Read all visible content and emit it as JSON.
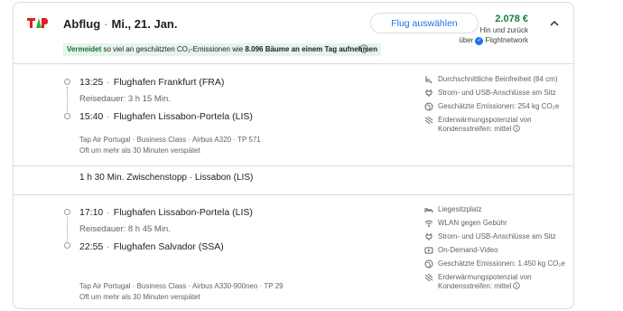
{
  "header": {
    "airline_logo": "TAP",
    "departure_label": "Abflug",
    "date": "Mi., 21. Jan.",
    "select_button": "Flug auswählen",
    "price": "2.078 €",
    "price_type": "Hin und zurück",
    "booking_via_prefix": "über",
    "booking_via": "Flightnetwork",
    "collapse_icon": "chevron-up-icon"
  },
  "emissions_banner": {
    "highlight": "Vermeidet",
    "text_middle": "so viel an geschätzten CO₂-Emissionen wie",
    "trees": "8.096 Bäume an einem Tag aufnehmen",
    "colors": {
      "highlight": "#137333",
      "background": "#e6f4ea"
    }
  },
  "segments": [
    {
      "dep_time": "13:25",
      "dep_airport": "Flughafen Frankfurt (FRA)",
      "duration": "Reisedauer: 3 h 15 Min.",
      "arr_time": "15:40",
      "arr_airport": "Flughafen Lissabon-Portela (LIS)",
      "airline": "Tap Air Portugal",
      "cabin": "Business Class",
      "aircraft": "Airbus A320",
      "flight_no": "TP 571",
      "delay_note": "Oft um mehr als 30 Minuten verspätet",
      "amenities": [
        {
          "icon": "seat-icon",
          "text": "Durchschnittliche Beinfreiheit (84 cm)"
        },
        {
          "icon": "power-plug-icon",
          "text": "Strom- und USB-Anschlüsse am Sitz"
        },
        {
          "icon": "emissions-icon",
          "text": "Geschätzte Emissionen: 254 kg CO₂e"
        },
        {
          "icon": "warming-icon",
          "text": "Erderwärmungspotenzial von",
          "text2": "Kondensstreifen: mittel"
        }
      ]
    },
    {
      "dep_time": "17:10",
      "dep_airport": "Flughafen Lissabon-Portela (LIS)",
      "duration": "Reisedauer: 8 h 45 Min.",
      "arr_time": "22:55",
      "arr_airport": "Flughafen Salvador (SSA)",
      "airline": "Tap Air Portugal",
      "cabin": "Business Class",
      "aircraft": "Airbus A330-900neo",
      "flight_no": "TP 29",
      "delay_note": "Oft um mehr als 30 Minuten verspätet",
      "amenities": [
        {
          "icon": "lie-flat-seat-icon",
          "text": "Liegesitzplatz"
        },
        {
          "icon": "wifi-icon",
          "text": "WLAN gegen Gebühr"
        },
        {
          "icon": "power-plug-icon",
          "text": "Strom- und USB-Anschlüsse am Sitz"
        },
        {
          "icon": "video-icon",
          "text": "On-Demand-Video"
        },
        {
          "icon": "emissions-icon",
          "text": "Geschätzte Emissionen: 1.450 kg CO₂e"
        },
        {
          "icon": "warming-icon",
          "text": "Erderwärmungspotenzial von",
          "text2": "Kondensstreifen: mittel"
        }
      ]
    }
  ],
  "layover": {
    "duration": "1 h 30 Min. Zwischenstopp",
    "city": "Lissabon (LIS)"
  }
}
